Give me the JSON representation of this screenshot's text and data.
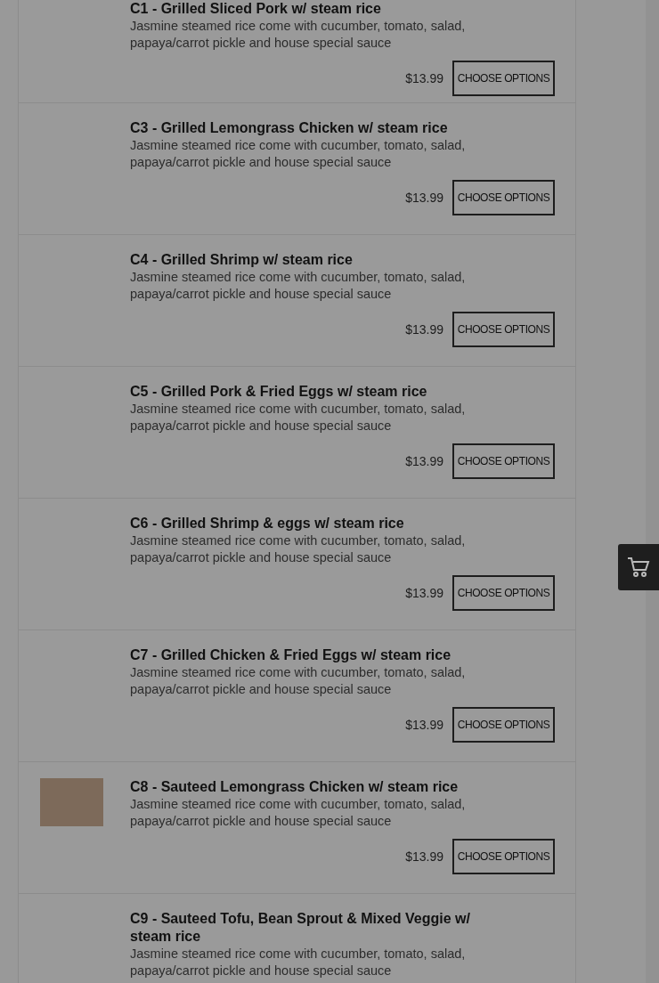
{
  "menu_items": [
    {
      "title": "C1 - Grilled Sliced Pork w/ steam rice",
      "description": "Jasmine steamed rice come with cucumber, tomato, salad, papaya/carrot pickle and house special sauce",
      "price": "$13.99",
      "button": "CHOOSE OPTIONS",
      "photo": false
    },
    {
      "title": "C3 - Grilled Lemongrass Chicken w/ steam rice",
      "description": "Jasmine steamed rice come with cucumber, tomato, salad, papaya/carrot pickle and house special sauce",
      "price": "$13.99",
      "button": "CHOOSE OPTIONS",
      "photo": false
    },
    {
      "title": "C4 - Grilled Shrimp w/ steam rice",
      "description": "Jasmine steamed rice come with cucumber, tomato, salad, papaya/carrot pickle and house special sauce",
      "price": "$13.99",
      "button": "CHOOSE OPTIONS",
      "photo": false
    },
    {
      "title": "C5 - Grilled Pork & Fried Eggs w/ steam rice",
      "description": "Jasmine steamed rice come with cucumber, tomato, salad, papaya/carrot pickle and house special sauce",
      "price": "$13.99",
      "button": "CHOOSE OPTIONS",
      "photo": false
    },
    {
      "title": "C6 - Grilled Shrimp & eggs w/ steam rice",
      "description": "Jasmine steamed rice come with cucumber, tomato, salad, papaya/carrot pickle and house special sauce",
      "price": "$13.99",
      "button": "CHOOSE OPTIONS",
      "photo": false
    },
    {
      "title": "C7 - Grilled Chicken & Fried Eggs w/ steam rice",
      "description": "Jasmine steamed rice come with cucumber, tomato, salad, papaya/carrot pickle and house special sauce",
      "price": "$13.99",
      "button": "CHOOSE OPTIONS",
      "photo": false
    },
    {
      "title": "C8 - Sauteed Lemongrass Chicken w/ steam rice",
      "description": "Jasmine steamed rice come with cucumber, tomato, salad, papaya/carrot pickle and house special sauce",
      "price": "$13.99",
      "button": "CHOOSE OPTIONS",
      "photo": true
    },
    {
      "title": "C9 - Sauteed Tofu, Bean Sprout & Mixed Veggie w/ steam rice",
      "description": "Jasmine steamed rice come with cucumber, tomato, salad, papaya/carrot pickle and house special sauce",
      "photo": false
    }
  ]
}
